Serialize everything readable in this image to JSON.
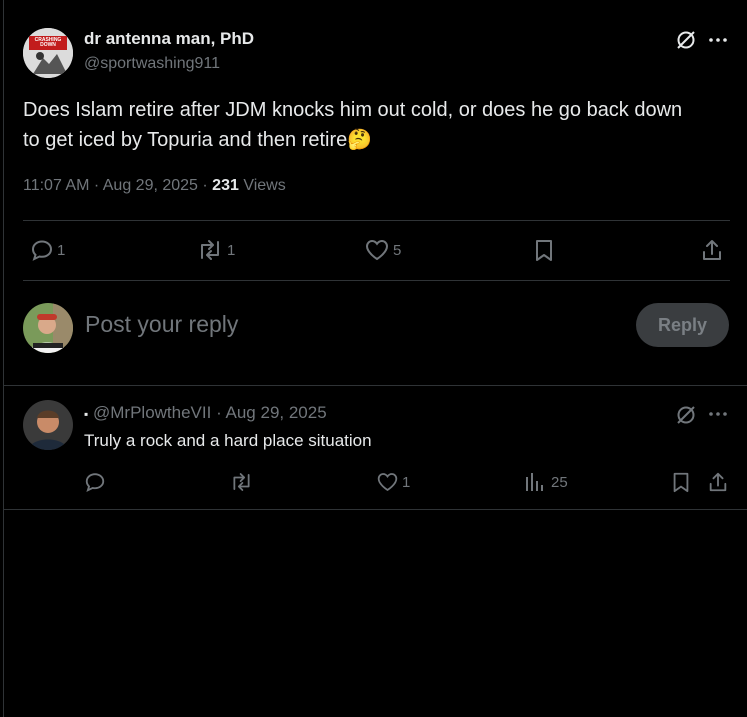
{
  "tweet": {
    "author_name": "dr antenna man, PhD",
    "author_handle": "@sportwashing911",
    "avatar_text": "CRASHING DOWN",
    "text": "Does Islam retire after JDM knocks him out cold, or does he go back down to get iced by Topuria and then retire",
    "emoji": "🤔",
    "time": "11:07 AM · Aug 29, 2025 · ",
    "views_count": "231",
    "views_label": " Views",
    "actions": {
      "replies": "1",
      "reposts": "1",
      "likes": "5"
    }
  },
  "composer": {
    "placeholder": "Post your reply",
    "reply_label": "Reply"
  },
  "reply": {
    "bullet": "▪",
    "meta": "@MrPlowtheVII · Aug 29, 2025",
    "text": "Truly a rock and a hard place situation",
    "actions": {
      "likes": "1",
      "views": "25"
    }
  },
  "colors": {
    "background": "#000000",
    "text": "#e7e9ea",
    "muted": "#71767b",
    "divider": "#2f3336",
    "reply_button": "#3a3d40"
  }
}
